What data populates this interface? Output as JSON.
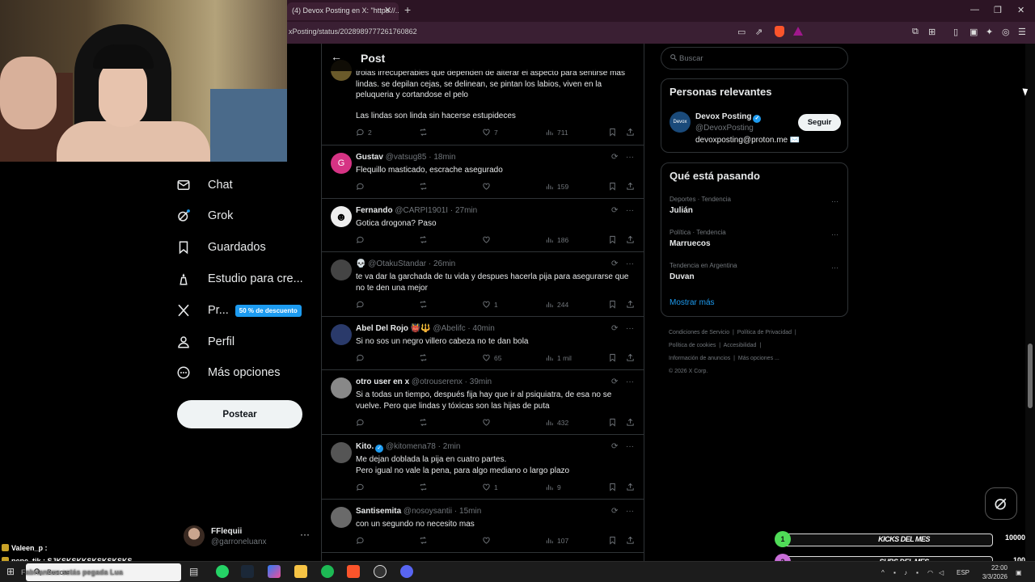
{
  "browser": {
    "tab_title": "(4) Devox Posting en X: \"https://...",
    "url": "xPosting/status/2028989777261760862"
  },
  "sidebar": {
    "items": [
      {
        "label": "Chat",
        "icon": "mail-icon"
      },
      {
        "label": "Grok",
        "icon": "grok-icon"
      },
      {
        "label": "Guardados",
        "icon": "bookmark-icon"
      },
      {
        "label": "Estudio para cre...",
        "icon": "creator-studio-icon"
      },
      {
        "label": "Pr...",
        "icon": "x-logo-icon",
        "badge": "50 % de descuento"
      },
      {
        "label": "Perfil",
        "icon": "profile-icon"
      },
      {
        "label": "Más opciones",
        "icon": "more-options-icon"
      }
    ],
    "post_button": "Postear",
    "account": {
      "name": "FFlequii",
      "handle": "@garroneluanx"
    }
  },
  "main": {
    "header_title": "Post",
    "partial_tweet": {
      "text": "trolas irrecuperables que dependen de alterar el aspecto para sentirse mas lindas. se depilan cejas, se delinean, se pintan los labios, viven en la peluqueria y cortandose el pelo",
      "text2": "Las lindas son linda sin hacerse estupideces",
      "replies": "2",
      "likes": "7",
      "views": "711"
    },
    "tweets": [
      {
        "name": "Gustav",
        "handle": "@vatsug85",
        "time": "18min",
        "text": "Flequillo masticado, escrache asegurado",
        "replies": "",
        "retweets": "",
        "likes": "",
        "views": "159"
      },
      {
        "name": "Fernando",
        "handle": "@CARPI1901I",
        "time": "27min",
        "text": "Gotica drogona? Paso",
        "replies": "",
        "retweets": "",
        "likes": "",
        "views": "186"
      },
      {
        "name": "💀",
        "handle": "@OtakuStandar",
        "time": "26min",
        "text": "te va dar la garchada de tu vida y despues hacerla pija para asegurarse que no te den una mejor",
        "replies": "",
        "retweets": "",
        "likes": "1",
        "views": "244"
      },
      {
        "name": "Abel Del Rojo 👹🔱",
        "handle": "@Abelifc",
        "time": "40min",
        "text": "Si no sos un negro villero cabeza no te dan bola",
        "replies": "",
        "retweets": "",
        "likes": "65",
        "views": "1 mil"
      },
      {
        "name": "otro user en x",
        "handle": "@otrouserenx",
        "time": "39min",
        "text": "Si a todas un tiempo, después fija hay que ir al psiquiatra, de esa no se vuelve. Pero que lindas y tóxicas son las hijas de puta",
        "replies": "",
        "retweets": "",
        "likes": "",
        "views": "432"
      },
      {
        "name": "Kito.",
        "handle": "@kitomena78",
        "time": "2min",
        "text": "Me dejan doblada la pija en cuatro partes.",
        "text2": "Pero igual no vale la pena, para algo mediano o largo plazo",
        "replies": "",
        "retweets": "",
        "likes": "1",
        "views": "9"
      },
      {
        "name": "Santisemita",
        "handle": "@nosoysantii",
        "time": "15min",
        "text": "con un segundo no necesito mas",
        "replies": "",
        "retweets": "",
        "likes": "",
        "views": "107"
      }
    ]
  },
  "right": {
    "search_placeholder": "Buscar",
    "relevant_title": "Personas relevantes",
    "relevant": {
      "name": "Devox Posting",
      "handle": "@DevoxPosting",
      "bio": "devoxposting@proton.me ✉️",
      "follow": "Seguir",
      "avatar_text": "Devox"
    },
    "trends_title": "Qué está pasando",
    "trends": [
      {
        "meta": "Deportes · Tendencia",
        "name": "Julián"
      },
      {
        "meta": "Política · Tendencia",
        "name": "Marruecos"
      },
      {
        "meta": "Tendencia en Argentina",
        "name": "Duvan"
      }
    ],
    "show_more": "Mostrar más",
    "footer": [
      "Condiciones de Servicio",
      "Política de Privacidad",
      "Política de cookies",
      "Accesibilidad",
      "Información de anuncios",
      "Más opciones ...",
      "© 2026 X Corp."
    ]
  },
  "overlays": {
    "goals": [
      {
        "num": "1",
        "label": "KICKS DEL MES",
        "count": "10000",
        "color": "#4fdc57",
        "progress": 0.0
      },
      {
        "num": "2",
        "label": "SUBS DEL MES",
        "count": "100",
        "color": "#c86dd7",
        "progress": 0.0
      }
    ],
    "chat": [
      {
        "user": "Valeen_p",
        "msg": ""
      },
      {
        "user": "pepe_tik",
        "msg": "SJKSKSKKSKSKSKSKS"
      },
      {
        "user": "Fabriannxx",
        "msg": "estás pegada Lua"
      }
    ]
  },
  "taskbar": {
    "search": "Buscar",
    "lang": "ESP",
    "time": "22:00",
    "date": "3/3/2026"
  }
}
